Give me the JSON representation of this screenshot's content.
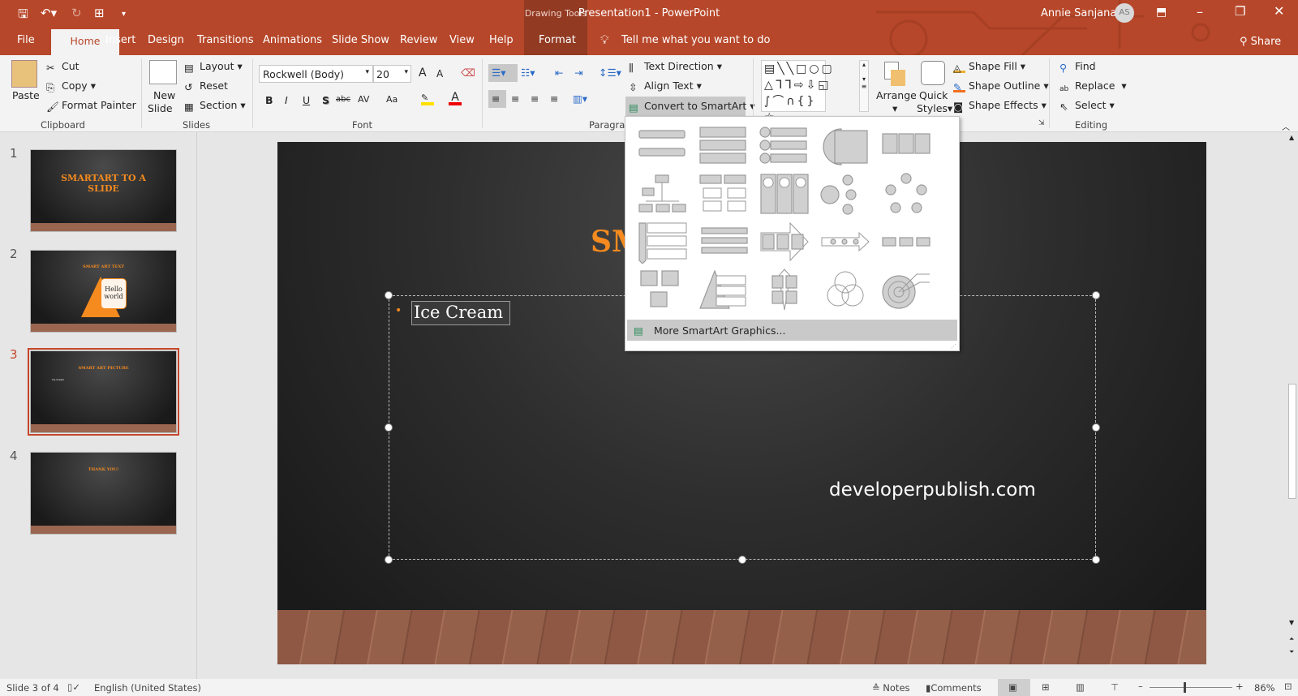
{
  "window": {
    "title": "Presentation1  -  PowerPoint",
    "context_tab_group": "Drawing Tools",
    "user_name": "Annie Sanjana",
    "user_initials": "AS",
    "share": "Share",
    "tell_me": "Tell me what you want to do"
  },
  "tabs": [
    "File",
    "Home",
    "Insert",
    "Design",
    "Transitions",
    "Animations",
    "Slide Show",
    "Review",
    "View",
    "Help",
    "Format"
  ],
  "active_tab": "Home",
  "ribbon": {
    "clipboard": {
      "label": "Clipboard",
      "paste": "Paste",
      "cut": "Cut",
      "copy": "Copy",
      "format_painter": "Format Painter"
    },
    "slides": {
      "label": "Slides",
      "new_slide_1": "New",
      "new_slide_2": "Slide",
      "layout": "Layout",
      "reset": "Reset",
      "section": "Section"
    },
    "font": {
      "label": "Font",
      "font_name": "Rockwell (Body)",
      "font_size": "20",
      "bold": "B",
      "italic": "I",
      "underline": "U",
      "shadow": "S",
      "strike": "abc",
      "spacing": "AV",
      "case": "Aa",
      "grow": "A",
      "shrink": "A"
    },
    "paragraph": {
      "label": "Paragraph",
      "text_direction": "Text Direction",
      "align_text": "Align Text",
      "convert_smartart": "Convert to SmartArt"
    },
    "drawing": {
      "arrange": "Arrange",
      "quick_styles_1": "Quick",
      "quick_styles_2": "Styles",
      "shape_fill": "Shape Fill",
      "shape_outline": "Shape Outline",
      "shape_effects": "Shape Effects"
    },
    "editing": {
      "label": "Editing",
      "find": "Find",
      "replace": "Replace",
      "select": "Select"
    }
  },
  "colors": {
    "accent": "#b7472a",
    "title_orange": "#f58a1f",
    "shape_fill_bar": "#f0b030",
    "outline_bar": "#f07020"
  },
  "slides": [
    {
      "number": "1",
      "title": "SMARTART TO A SLIDE"
    },
    {
      "number": "2",
      "title": "SMART ART TEXT",
      "callout": "Hello world"
    },
    {
      "number": "3",
      "title": "SMART ART PICTURE",
      "bullet": "Ice Cream"
    },
    {
      "number": "4",
      "title": "THANK YOU!"
    }
  ],
  "current_slide": {
    "title_visible": "SM",
    "bullet": "Ice Cream",
    "watermark": "developerpublish.com"
  },
  "smartart_menu": {
    "layouts": [
      "vertical-bullet-list",
      "stacked-list",
      "vertical-circle-list",
      "nested-arc-list",
      "table-list",
      "organization-chart",
      "hierarchy-list",
      "picture-accent-process",
      "bubble-list",
      "cycle",
      "vertical-chevron-list",
      "chevron-process",
      "upward-arrow-process",
      "timeline-arrow",
      "basic-process",
      "picture-caption-list",
      "pyramid-list",
      "cross-arrows",
      "venn",
      "target"
    ],
    "more": "More SmartArt Graphics..."
  },
  "status": {
    "slide_of": "Slide 3 of 4",
    "language": "English (United States)",
    "notes": "Notes",
    "comments": "Comments",
    "zoom": "86%",
    "zoom_level": 86
  }
}
